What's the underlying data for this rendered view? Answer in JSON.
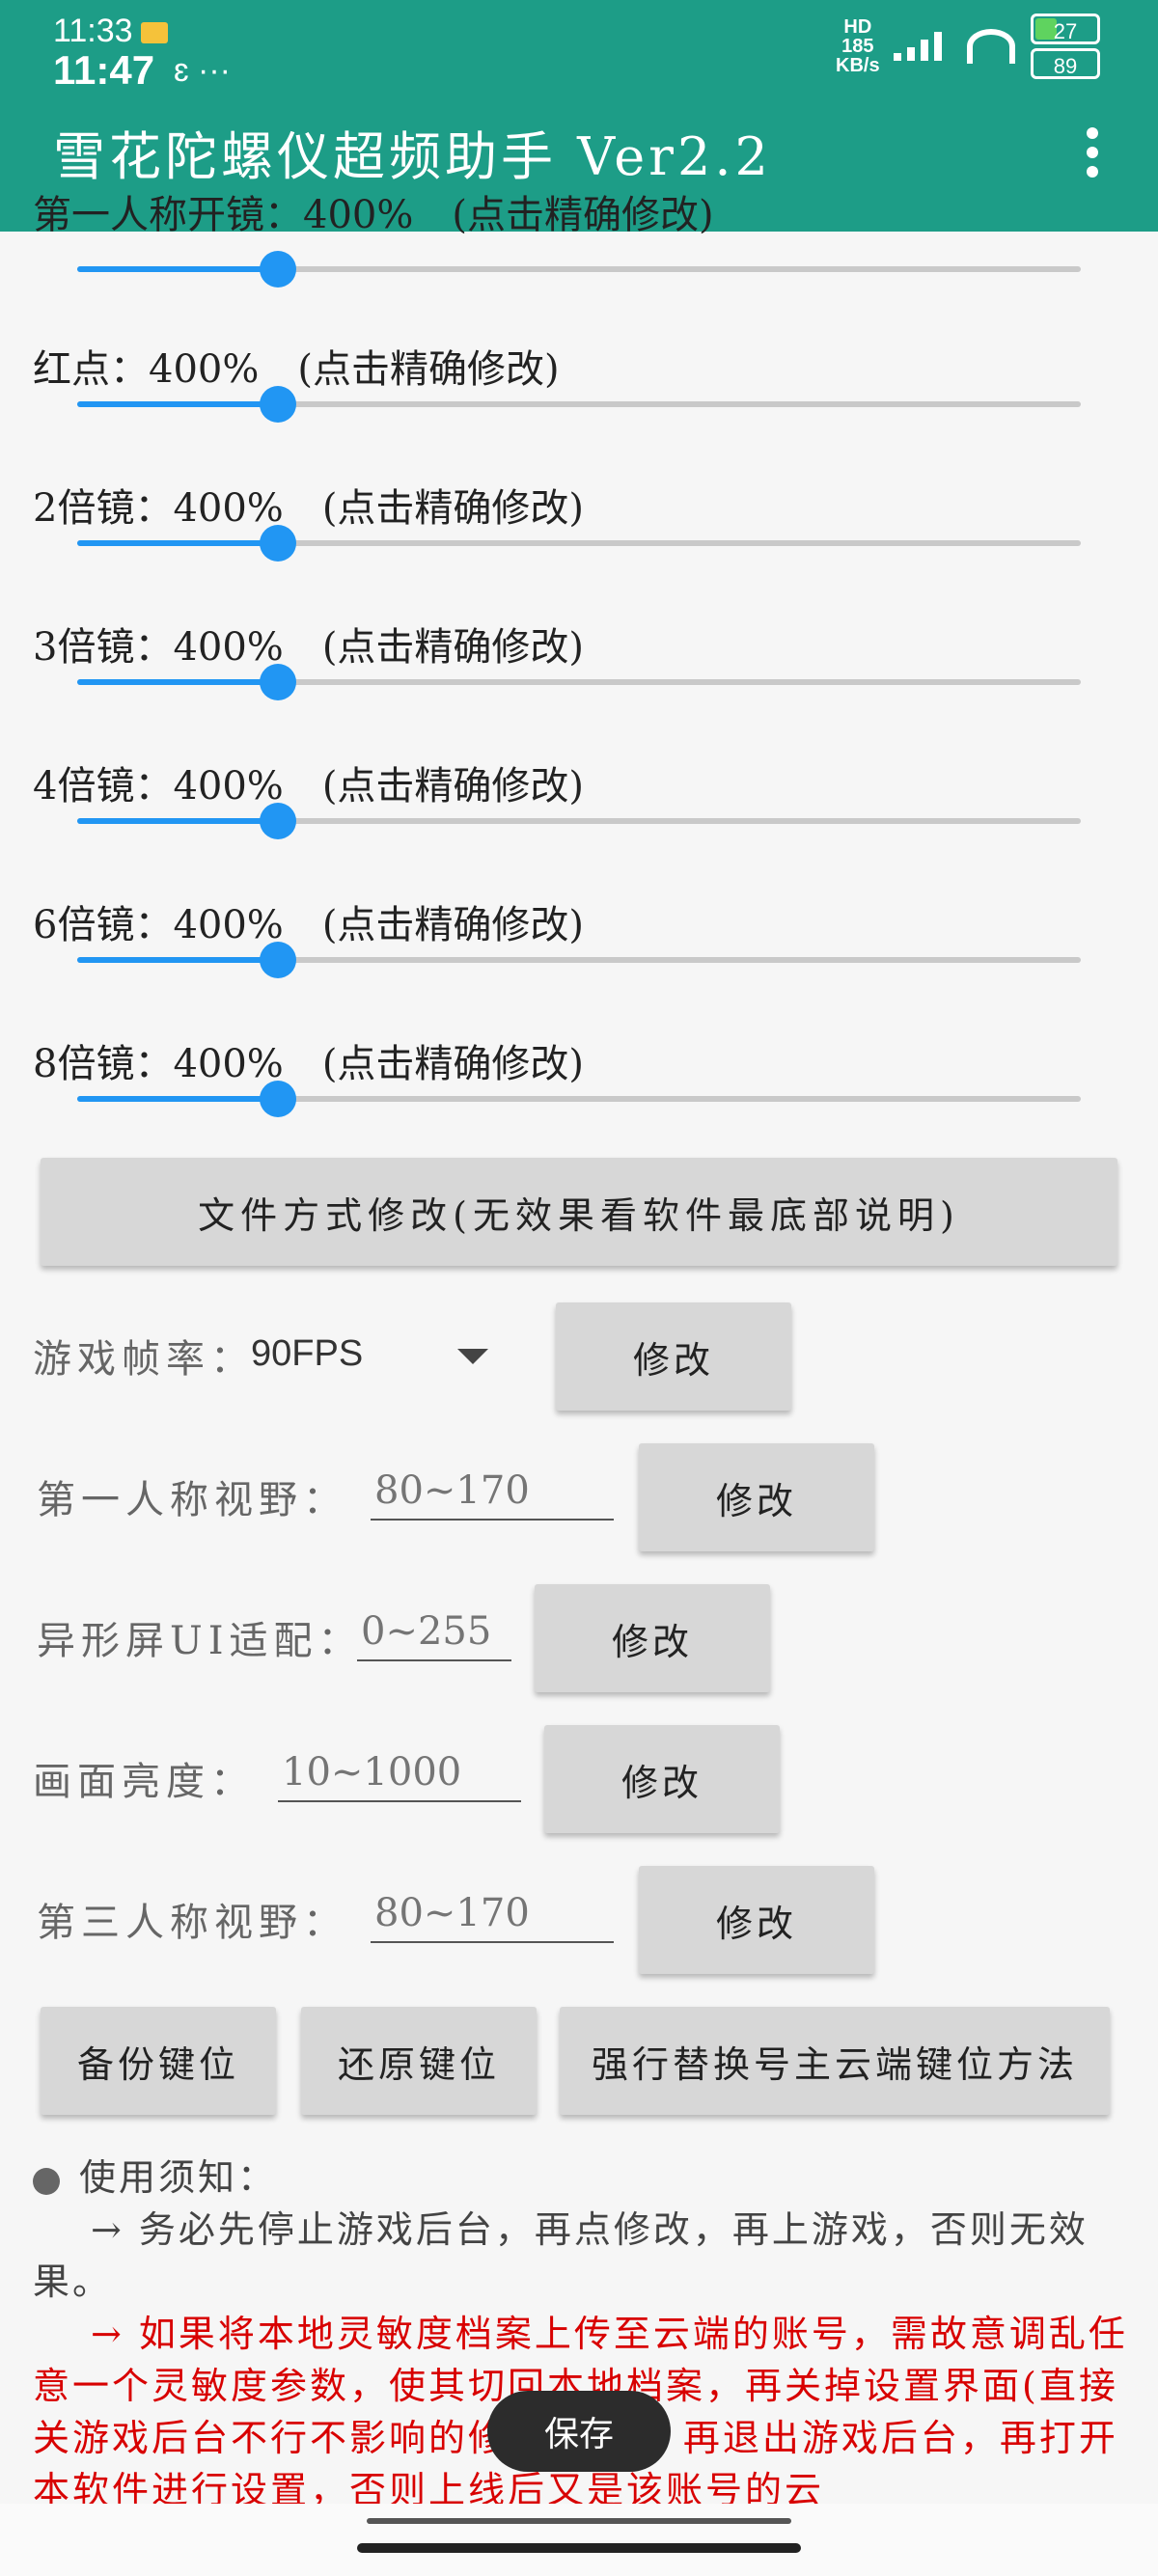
{
  "status_bar": {
    "time_top": "11:33",
    "time_main": "11:47",
    "misc": "ɛ ···",
    "net_speed_value": "185",
    "net_speed_unit": "KB/s",
    "hd_label": "HD",
    "battery_top": "27",
    "battery_bottom": "89"
  },
  "app_bar": {
    "title": "雪花陀螺仪超频助手 Ver2.2"
  },
  "sliders": [
    {
      "label": "第一人称开镜：400%",
      "hint": "(点击精确修改)",
      "value_percent": 400,
      "fraction": 0.2
    },
    {
      "label": "红点：400%",
      "hint": "(点击精确修改)",
      "value_percent": 400,
      "fraction": 0.2
    },
    {
      "label": "2倍镜：400%",
      "hint": "(点击精确修改)",
      "value_percent": 400,
      "fraction": 0.2
    },
    {
      "label": "3倍镜：400%",
      "hint": "(点击精确修改)",
      "value_percent": 400,
      "fraction": 0.2
    },
    {
      "label": "4倍镜：400%",
      "hint": "(点击精确修改)",
      "value_percent": 400,
      "fraction": 0.2
    },
    {
      "label": "6倍镜：400%",
      "hint": "(点击精确修改)",
      "value_percent": 400,
      "fraction": 0.2
    },
    {
      "label": "8倍镜：400%",
      "hint": "(点击精确修改)",
      "value_percent": 400,
      "fraction": 0.2
    }
  ],
  "file_mode_button": "文件方式修改(无效果看软件最底部说明)",
  "fps": {
    "label": "游戏帧率：",
    "value": "90FPS",
    "button": "修改"
  },
  "fields": [
    {
      "label": "第一人称视野：",
      "placeholder": "80~170",
      "button": "修改"
    },
    {
      "label": "异形屏UI适配：",
      "placeholder": "0~255",
      "button": "修改"
    },
    {
      "label": "画面亮度：",
      "placeholder": "10~1000",
      "button": "修改"
    },
    {
      "label": "第三人称视野：",
      "placeholder": "80~170",
      "button": "修改"
    }
  ],
  "key_buttons": {
    "backup": "备份键位",
    "restore": "还原键位",
    "force": "强行替换号主云端键位方法"
  },
  "notes": {
    "heading": "使用须知：",
    "line1": "→ 务必先停止游戏后台，再点修改，再上游戏，否则无效果。",
    "line2": "→ 如果将本地灵敏度档案上传至云端的账号，需故意调乱任意一个灵敏度参数，使其切回本地档案，再关掉设置界面(直接关游戏后台不行不影响的修改操作)，再退出游戏后台，再打开本软件进行设置，否则上线后又是该账号的云"
  },
  "toast": "保存",
  "colors": {
    "app_bar": "#1d9d87",
    "slider_accent": "#2196f3",
    "warning_text": "#d80000"
  }
}
